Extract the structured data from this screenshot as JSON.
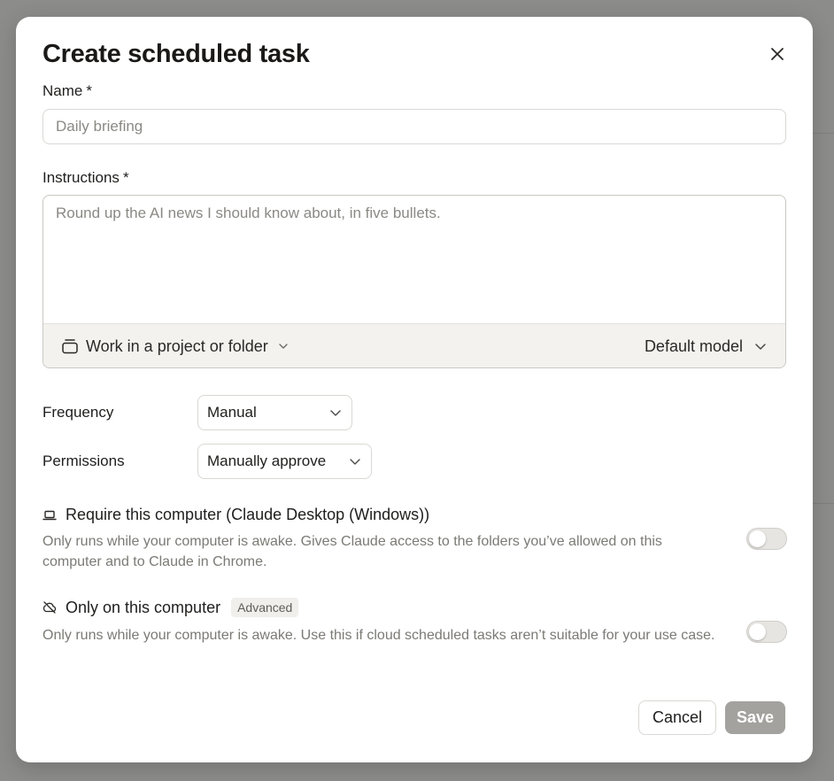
{
  "dialog": {
    "title": "Create scheduled task",
    "name_label": "Name",
    "required_mark": "*",
    "name_placeholder": "Daily briefing",
    "instructions_label": "Instructions",
    "instructions_placeholder": "Round up the AI news I should know about, in five bullets.",
    "project_button_label": "Work in a project or folder",
    "model_button_label": "Default model",
    "frequency_label": "Frequency",
    "frequency_value": "Manual",
    "permissions_label": "Permissions",
    "permissions_value": "Manually approve",
    "options": [
      {
        "title": "Require this computer (Claude Desktop (Windows))",
        "description": "Only runs while your computer is awake. Gives Claude access to the folders you’ve allowed on this computer and to Claude in Chrome.",
        "enabled": false,
        "icon": "laptop-icon"
      },
      {
        "title": "Only on this computer",
        "badge": "Advanced",
        "description": "Only runs while your computer is awake. Use this if cloud scheduled tasks aren’t suitable for your use case.",
        "enabled": false,
        "icon": "cloud-off-icon"
      }
    ],
    "cancel_label": "Cancel",
    "save_label": "Save"
  },
  "colors": {
    "overlay": "#8c8c8a",
    "save_disabled": "#a3a29e",
    "input_border": "#d9d8d4",
    "muted_text": "#7b7a75"
  }
}
